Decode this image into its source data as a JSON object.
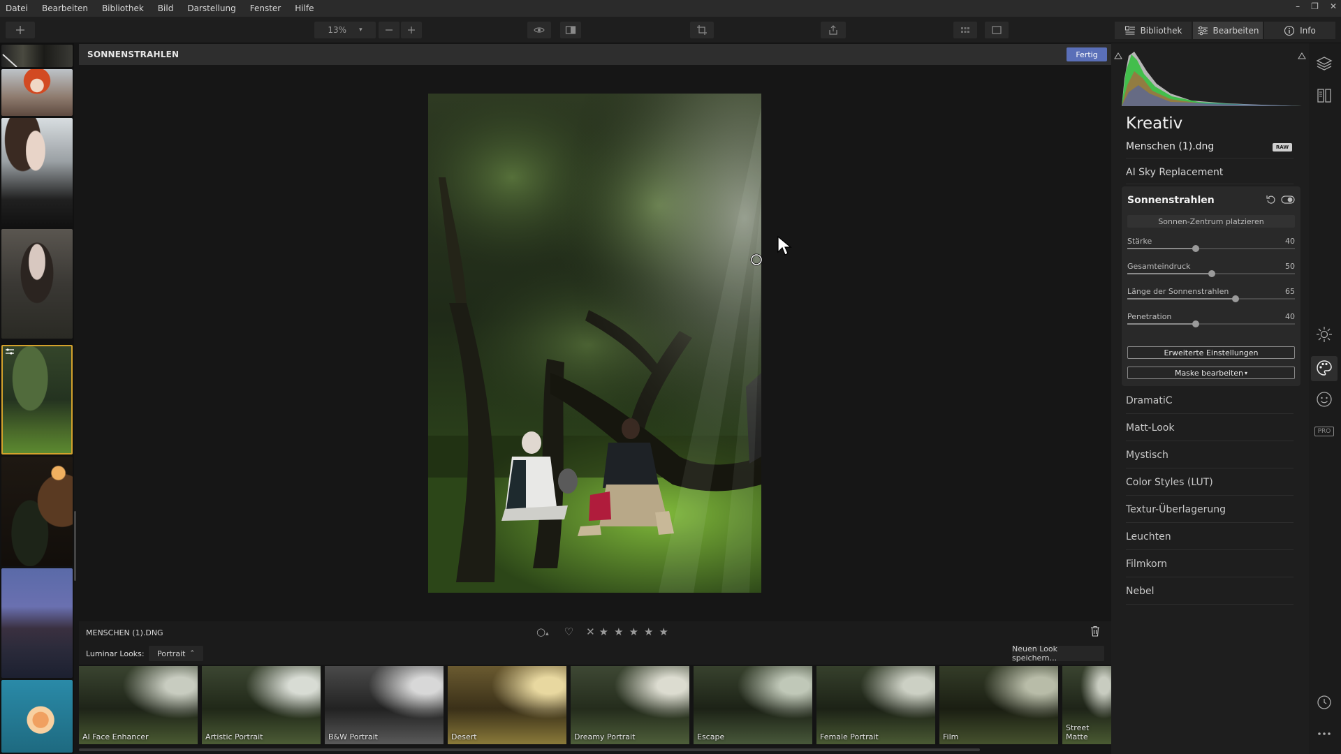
{
  "menu": [
    "Datei",
    "Bearbeiten",
    "Bibliothek",
    "Bild",
    "Darstellung",
    "Fenster",
    "Hilfe"
  ],
  "toolbar": {
    "zoom": "13%"
  },
  "tabs": [
    {
      "label": "Bibliothek",
      "icon": "library-icon"
    },
    {
      "label": "Bearbeiten",
      "icon": "sliders-icon"
    },
    {
      "label": "Info",
      "icon": "info-icon"
    }
  ],
  "center": {
    "title": "SONNENSTRAHLEN",
    "done_label": "Fertig"
  },
  "infobar": {
    "file": "MENSCHEN (1).DNG"
  },
  "looks": {
    "label": "Luminar Looks:",
    "category": "Portrait",
    "save_label": "Neuen Look speichern...",
    "items": [
      "AI Face Enhancer",
      "Artistic Portrait",
      "B&W Portrait",
      "Desert",
      "Dreamy Portrait",
      "Escape",
      "Female Portrait",
      "Film",
      "Street Matte"
    ]
  },
  "panel": {
    "title": "Kreativ",
    "filename": "Menschen (1).dng",
    "raw_badge": "RAW",
    "ai_sky": "AI Sky Replacement",
    "filter": {
      "name": "Sonnenstrahlen",
      "place_label": "Sonnen-Zentrum platzieren",
      "sliders": [
        {
          "label": "Stärke",
          "value": "40"
        },
        {
          "label": "Gesamteindruck",
          "value": "50"
        },
        {
          "label": "Länge der Sonnenstrahlen",
          "value": "65"
        },
        {
          "label": "Penetration",
          "value": "40"
        }
      ],
      "advanced_label": "Erweiterte Einstellungen",
      "mask_label": "Maske bearbeiten"
    },
    "filters": [
      "DramatiC",
      "Matt-Look",
      "Mystisch",
      "Color Styles (LUT)",
      "Textur-Überlagerung",
      "Leuchten",
      "Filmkorn",
      "Nebel"
    ]
  },
  "iconcol": {
    "pro_label": "PRO"
  }
}
